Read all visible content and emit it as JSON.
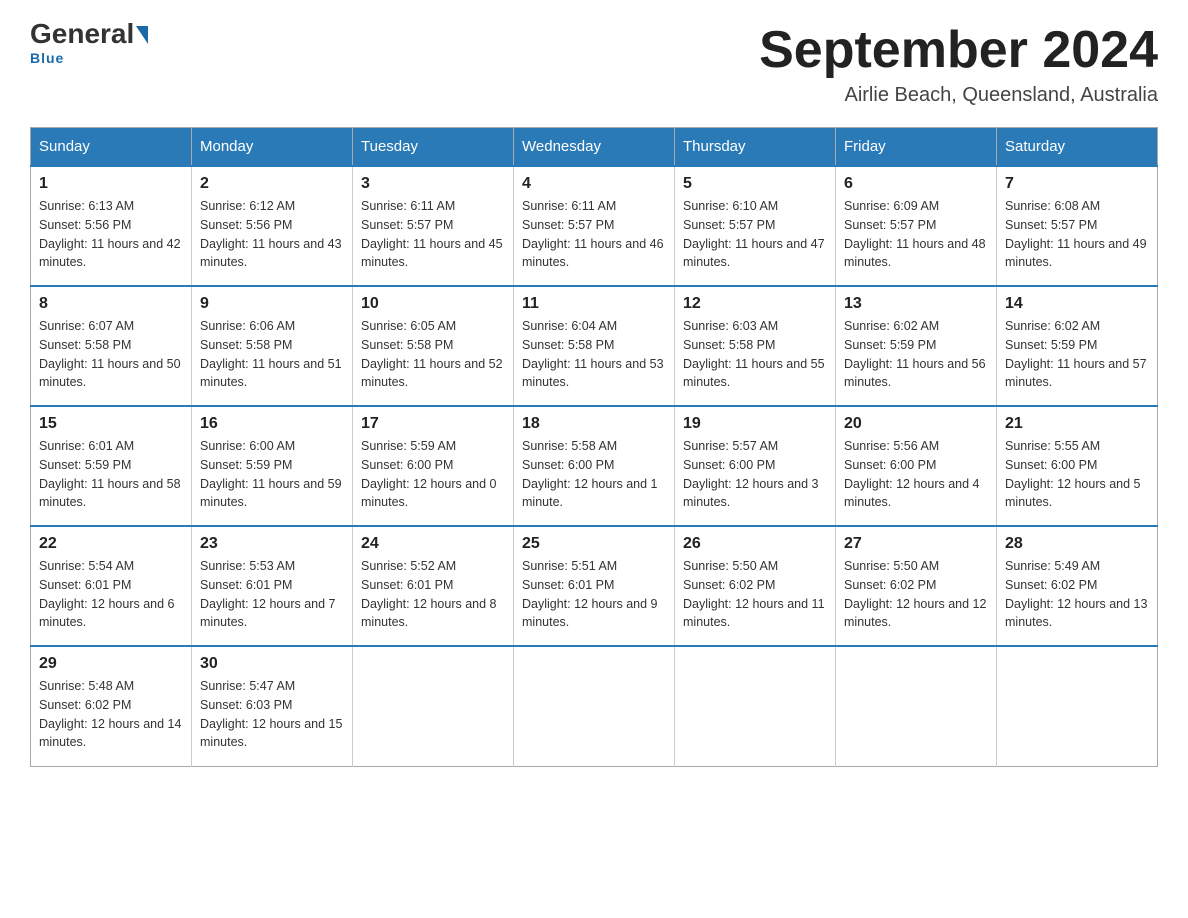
{
  "logo": {
    "general": "General",
    "blue": "Blue",
    "underline": "Blue"
  },
  "title": "September 2024",
  "subtitle": "Airlie Beach, Queensland, Australia",
  "calendar": {
    "headers": [
      "Sunday",
      "Monday",
      "Tuesday",
      "Wednesday",
      "Thursday",
      "Friday",
      "Saturday"
    ],
    "weeks": [
      [
        {
          "day": "1",
          "sunrise": "6:13 AM",
          "sunset": "5:56 PM",
          "daylight": "11 hours and 42 minutes."
        },
        {
          "day": "2",
          "sunrise": "6:12 AM",
          "sunset": "5:56 PM",
          "daylight": "11 hours and 43 minutes."
        },
        {
          "day": "3",
          "sunrise": "6:11 AM",
          "sunset": "5:57 PM",
          "daylight": "11 hours and 45 minutes."
        },
        {
          "day": "4",
          "sunrise": "6:11 AM",
          "sunset": "5:57 PM",
          "daylight": "11 hours and 46 minutes."
        },
        {
          "day": "5",
          "sunrise": "6:10 AM",
          "sunset": "5:57 PM",
          "daylight": "11 hours and 47 minutes."
        },
        {
          "day": "6",
          "sunrise": "6:09 AM",
          "sunset": "5:57 PM",
          "daylight": "11 hours and 48 minutes."
        },
        {
          "day": "7",
          "sunrise": "6:08 AM",
          "sunset": "5:57 PM",
          "daylight": "11 hours and 49 minutes."
        }
      ],
      [
        {
          "day": "8",
          "sunrise": "6:07 AM",
          "sunset": "5:58 PM",
          "daylight": "11 hours and 50 minutes."
        },
        {
          "day": "9",
          "sunrise": "6:06 AM",
          "sunset": "5:58 PM",
          "daylight": "11 hours and 51 minutes."
        },
        {
          "day": "10",
          "sunrise": "6:05 AM",
          "sunset": "5:58 PM",
          "daylight": "11 hours and 52 minutes."
        },
        {
          "day": "11",
          "sunrise": "6:04 AM",
          "sunset": "5:58 PM",
          "daylight": "11 hours and 53 minutes."
        },
        {
          "day": "12",
          "sunrise": "6:03 AM",
          "sunset": "5:58 PM",
          "daylight": "11 hours and 55 minutes."
        },
        {
          "day": "13",
          "sunrise": "6:02 AM",
          "sunset": "5:59 PM",
          "daylight": "11 hours and 56 minutes."
        },
        {
          "day": "14",
          "sunrise": "6:02 AM",
          "sunset": "5:59 PM",
          "daylight": "11 hours and 57 minutes."
        }
      ],
      [
        {
          "day": "15",
          "sunrise": "6:01 AM",
          "sunset": "5:59 PM",
          "daylight": "11 hours and 58 minutes."
        },
        {
          "day": "16",
          "sunrise": "6:00 AM",
          "sunset": "5:59 PM",
          "daylight": "11 hours and 59 minutes."
        },
        {
          "day": "17",
          "sunrise": "5:59 AM",
          "sunset": "6:00 PM",
          "daylight": "12 hours and 0 minutes."
        },
        {
          "day": "18",
          "sunrise": "5:58 AM",
          "sunset": "6:00 PM",
          "daylight": "12 hours and 1 minute."
        },
        {
          "day": "19",
          "sunrise": "5:57 AM",
          "sunset": "6:00 PM",
          "daylight": "12 hours and 3 minutes."
        },
        {
          "day": "20",
          "sunrise": "5:56 AM",
          "sunset": "6:00 PM",
          "daylight": "12 hours and 4 minutes."
        },
        {
          "day": "21",
          "sunrise": "5:55 AM",
          "sunset": "6:00 PM",
          "daylight": "12 hours and 5 minutes."
        }
      ],
      [
        {
          "day": "22",
          "sunrise": "5:54 AM",
          "sunset": "6:01 PM",
          "daylight": "12 hours and 6 minutes."
        },
        {
          "day": "23",
          "sunrise": "5:53 AM",
          "sunset": "6:01 PM",
          "daylight": "12 hours and 7 minutes."
        },
        {
          "day": "24",
          "sunrise": "5:52 AM",
          "sunset": "6:01 PM",
          "daylight": "12 hours and 8 minutes."
        },
        {
          "day": "25",
          "sunrise": "5:51 AM",
          "sunset": "6:01 PM",
          "daylight": "12 hours and 9 minutes."
        },
        {
          "day": "26",
          "sunrise": "5:50 AM",
          "sunset": "6:02 PM",
          "daylight": "12 hours and 11 minutes."
        },
        {
          "day": "27",
          "sunrise": "5:50 AM",
          "sunset": "6:02 PM",
          "daylight": "12 hours and 12 minutes."
        },
        {
          "day": "28",
          "sunrise": "5:49 AM",
          "sunset": "6:02 PM",
          "daylight": "12 hours and 13 minutes."
        }
      ],
      [
        {
          "day": "29",
          "sunrise": "5:48 AM",
          "sunset": "6:02 PM",
          "daylight": "12 hours and 14 minutes."
        },
        {
          "day": "30",
          "sunrise": "5:47 AM",
          "sunset": "6:03 PM",
          "daylight": "12 hours and 15 minutes."
        },
        null,
        null,
        null,
        null,
        null
      ]
    ]
  }
}
